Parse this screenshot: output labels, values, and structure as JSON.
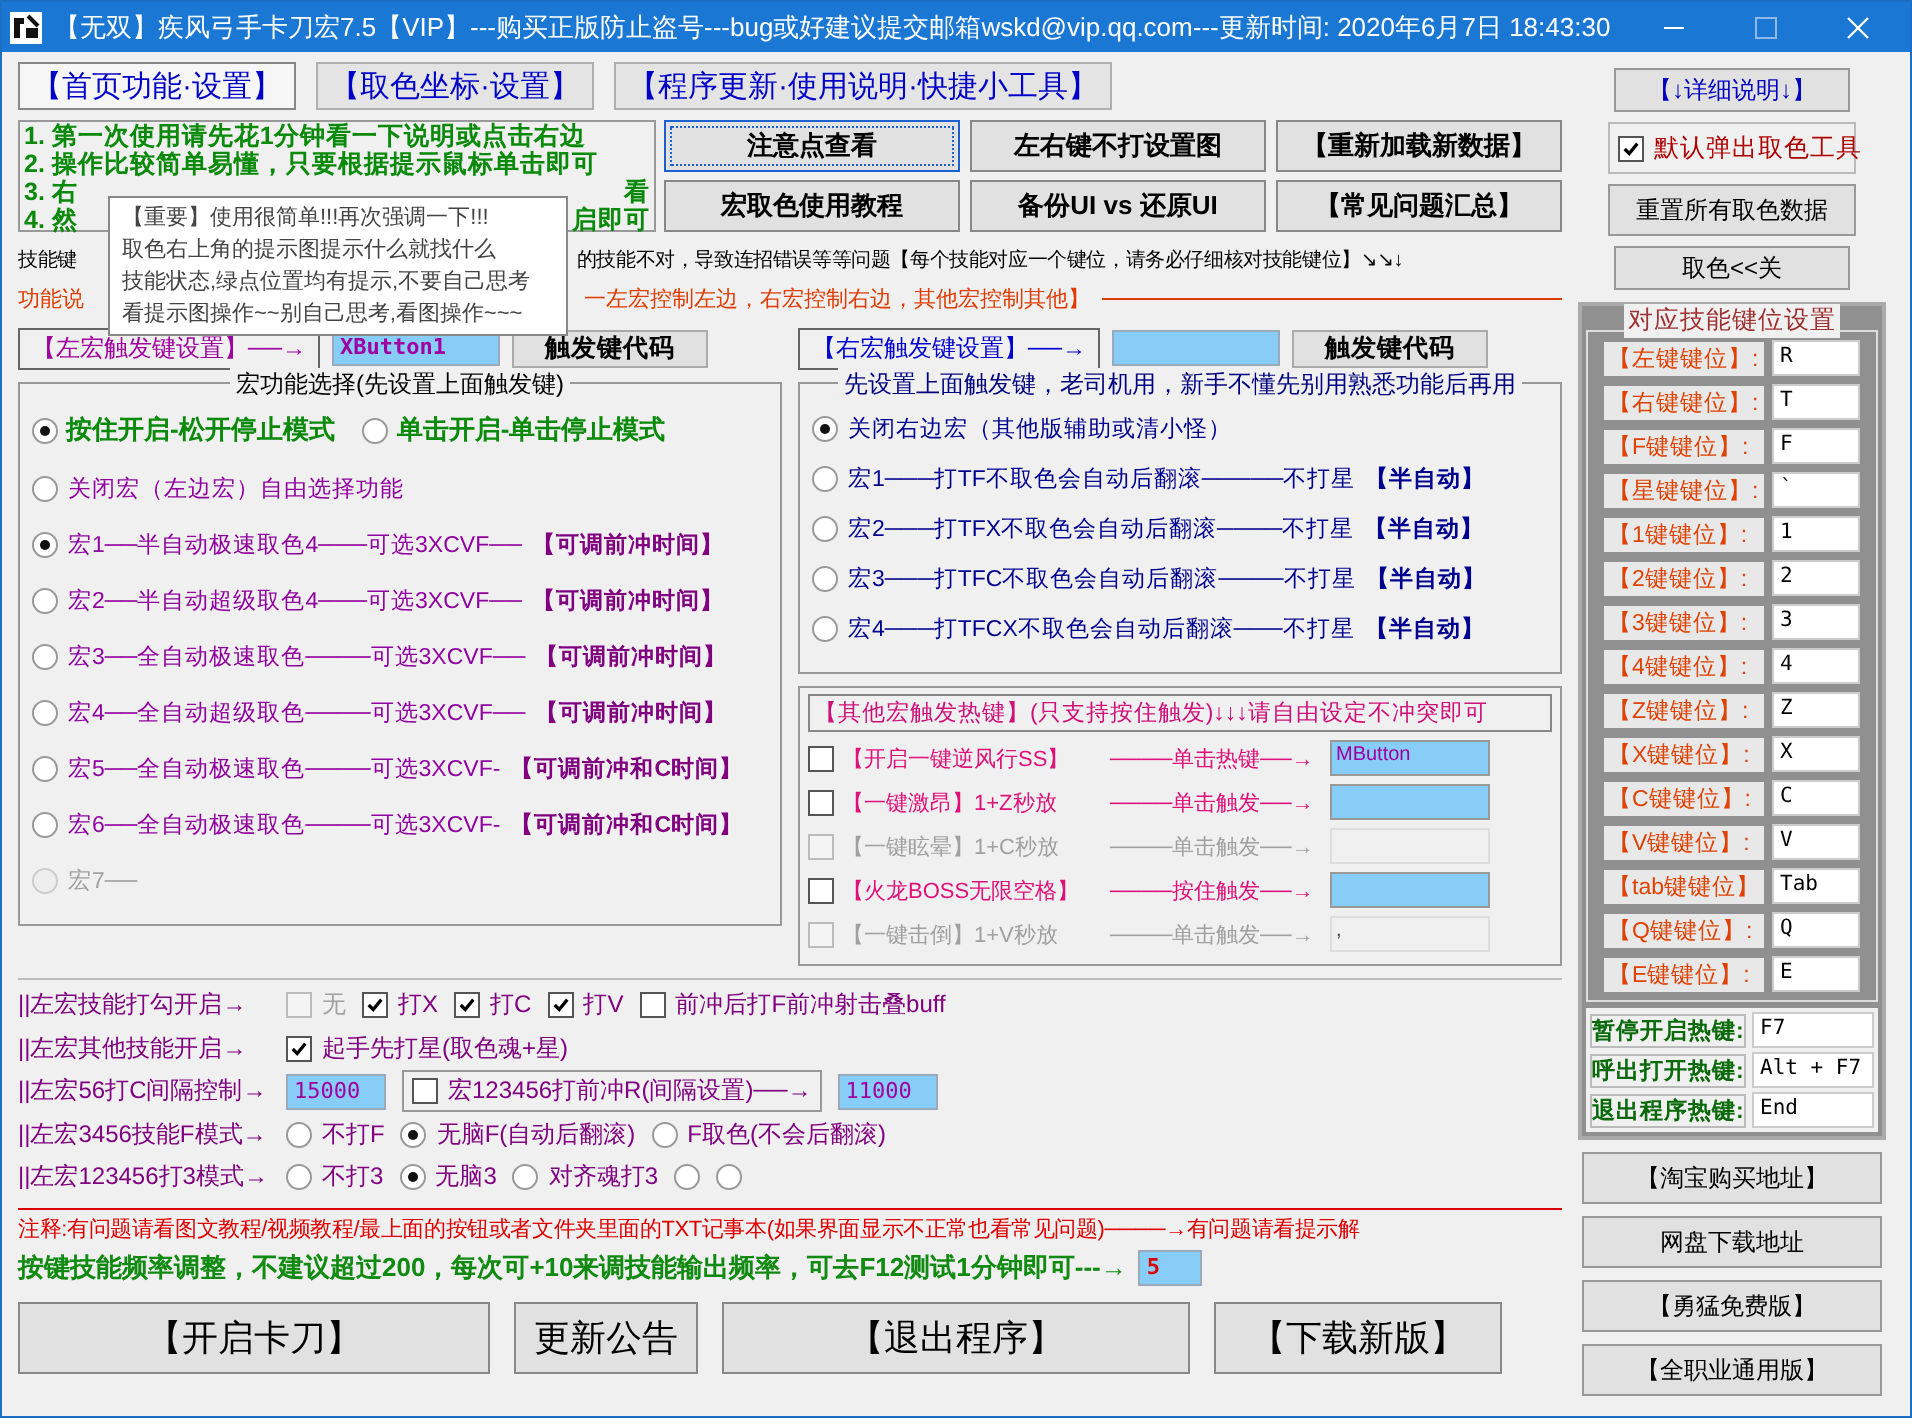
{
  "window": {
    "title": "【无双】疾风弓手卡刀宏7.5【VIP】---购买正版防止盗号---bug或好建议提交邮箱wskd@vip.qq.com---更新时间: 2020年6月7日 18:43:30"
  },
  "tabs": [
    {
      "label": "【首页功能·设置】",
      "selected": true
    },
    {
      "label": "【取色坐标·设置】",
      "selected": false
    },
    {
      "label": "【程序更新·使用说明·快捷小工具】",
      "selected": false
    }
  ],
  "intro_lines": [
    [
      "1. 第一次使用请先花1分钟看一下说明或点击右边"
    ],
    [
      "2. 操作比较简单易懂，只要根据提示鼠标单击即可"
    ],
    [
      "3. 右",
      "看"
    ],
    [
      "4. 然",
      "启即可"
    ]
  ],
  "top_buttons": [
    {
      "label": "注意点查看",
      "focused": true
    },
    {
      "label": "左右键不打设置图",
      "focused": false
    },
    {
      "label": "【重新加载新数据】",
      "focused": false
    },
    {
      "label": "宏取色使用教程",
      "focused": false
    },
    {
      "label": "备份UI vs 还原UI",
      "focused": false
    },
    {
      "label": "【常见问题汇总】",
      "focused": false
    }
  ],
  "tooltip": [
    "【重要】使用很简单!!!再次强调一下!!!",
    "取色右上角的提示图提示什么就找什么",
    "技能状态,绿点位置均有提示,不要自己思考",
    "看提示图操作~~别自己思考,看图操作~~~"
  ],
  "info_line": {
    "start": "技能键",
    "end": "的技能不对，导致连招错误等等问题【每个技能对应一个键位，请务必仔细核对技能键位】↘↘↓"
  },
  "function_line": {
    "start": "功能说",
    "end": "一左宏控制左边，右宏控制右边，其他宏控制其他】"
  },
  "left_trigger": {
    "label": "【左宏触发键设置】──→",
    "value": "XButton1",
    "button": "触发键代码"
  },
  "right_trigger": {
    "label": "【右宏触发键设置】──→",
    "button": "触发键代码"
  },
  "left_group": {
    "title": "宏功能选择(先设置上面触发键)",
    "modes": [
      {
        "label": "按住开启-松开停止模式",
        "selected": true
      },
      {
        "label": "单击开启-单击停止模式",
        "selected": false
      }
    ],
    "options": [
      {
        "label": "关闭宏（左边宏）自由选择功能",
        "selected": false,
        "disabled": false
      },
      {
        "label": "宏1──半自动极速取色4───可选3XCVF──",
        "note": "【可调前冲时间】",
        "selected": true,
        "disabled": false
      },
      {
        "label": "宏2──半自动超级取色4───可选3XCVF──",
        "note": "【可调前冲时间】",
        "selected": false,
        "disabled": false
      },
      {
        "label": "宏3──全自动极速取色────可选3XCVF──",
        "note": "【可调前冲时间】",
        "selected": false,
        "disabled": false
      },
      {
        "label": "宏4──全自动超级取色────可选3XCVF──",
        "note": "【可调前冲时间】",
        "selected": false,
        "disabled": false
      },
      {
        "label": "宏5──全自动极速取色────可选3XCVF-",
        "note": "【可调前冲和C时间】",
        "selected": false,
        "disabled": false
      },
      {
        "label": "宏6──全自动极速取色────可选3XCVF-",
        "note": "【可调前冲和C时间】",
        "selected": false,
        "disabled": false
      },
      {
        "label": "宏7──",
        "selected": false,
        "disabled": true
      }
    ]
  },
  "right_group": {
    "title": "先设置上面触发键，老司机用，新手不懂先别用熟悉功能后再用",
    "options": [
      {
        "label": "关闭右边宏（其他版辅助或清小怪）",
        "selected": true
      },
      {
        "label": "宏1───打TF不取色会自动后翻滚─────不打星",
        "note": "【半自动】",
        "selected": false
      },
      {
        "label": "宏2───打TFX不取色会自动后翻滚────不打星",
        "note": "【半自动】",
        "selected": false
      },
      {
        "label": "宏3───打TFC不取色会自动后翻滚────不打星",
        "note": "【半自动】",
        "selected": false
      },
      {
        "label": "宏4───打TFCX不取色会自动后翻滚───不打星",
        "note": "【半自动】",
        "selected": false
      }
    ]
  },
  "other_hotkeys": {
    "title": "【其他宏触发热键】(只支持按住触发)↓↓↓请自由设定不冲突即可",
    "rows": [
      {
        "label": "【开启一键逆风行SS】",
        "action": "────单击热键──→",
        "value": "MButton",
        "checked": false,
        "disabled": false
      },
      {
        "label": "【一键激昂】1+Z秒放",
        "action": "────单击触发──→",
        "checked": false,
        "disabled": false
      },
      {
        "label": "【一键眩晕】1+C秒放",
        "action": "────单击触发──→",
        "checked": false,
        "disabled": true
      },
      {
        "label": "【火龙BOSS无限空格】",
        "action": "────按住触发──→",
        "checked": false,
        "disabled": false
      },
      {
        "label": "【一键击倒】1+V秒放",
        "action": "────单击触发──→",
        "value": ",",
        "checked": false,
        "disabled": true
      }
    ]
  },
  "options_rows": [
    {
      "label": "||左宏技能打勾开启→",
      "controls": [
        {
          "kind": "check",
          "label": "无",
          "checked": false,
          "disabled": true
        },
        {
          "kind": "check",
          "label": "打X",
          "checked": true,
          "disabled": false
        },
        {
          "kind": "check",
          "label": "打C",
          "checked": true,
          "disabled": false
        },
        {
          "kind": "check",
          "label": "打V",
          "checked": true,
          "disabled": false
        },
        {
          "kind": "check",
          "label": "前冲后打F前冲射击叠buff",
          "checked": false,
          "disabled": false
        }
      ]
    },
    {
      "label": "||左宏其他技能开启→",
      "controls": [
        {
          "kind": "check",
          "label": "起手先打星(取色魂+星)",
          "checked": true,
          "disabled": false
        }
      ]
    },
    {
      "label": "||左宏56打C间隔控制→",
      "controls": [
        {
          "kind": "field",
          "value": "15000"
        },
        {
          "kind": "check",
          "label": "宏123456打前冲R(间隔设置)──→",
          "checked": false,
          "disabled": false,
          "framed": true
        },
        {
          "kind": "field",
          "value": "11000"
        }
      ]
    },
    {
      "label": "||左宏3456技能F模式→",
      "controls": [
        {
          "kind": "radio",
          "label": "不打F",
          "selected": false
        },
        {
          "kind": "radio",
          "label": "无脑F(自动后翻滚)",
          "selected": true
        },
        {
          "kind": "radio",
          "label": "F取色(不会后翻滚)",
          "selected": false
        }
      ]
    },
    {
      "label": "||左宏123456打3模式→",
      "controls": [
        {
          "kind": "radio",
          "label": "不打3",
          "selected": false
        },
        {
          "kind": "radio",
          "label": "无脑3",
          "selected": true
        },
        {
          "kind": "radio",
          "label": "对齐魂打3",
          "selected": false
        },
        {
          "kind": "radio",
          "selected": false
        },
        {
          "kind": "radio",
          "selected": false
        }
      ]
    }
  ],
  "note": "注释:有问题请看图文教程/视频教程/最上面的按钮或者文件夹里面的TXT记事本(如果界面显示不正常也看常见问题)────→有问题请看提示解",
  "frequency": {
    "text": "按键技能频率调整，不建议超过200，每次可+10来调技能输出频率，可去F12测试1分钟即可---→",
    "value": "5"
  },
  "bottom_buttons": [
    "【开启卡刀】",
    "更新公告",
    "【退出程序】",
    "【下载新版】"
  ],
  "right_panel": {
    "detail_button": "【↓详细说明↓】",
    "popup_check": {
      "label": "默认弹出取色工具",
      "checked": true
    },
    "buttons": [
      "重置所有取色数据",
      "取色<<关"
    ],
    "keys_title": "对应技能键位设置",
    "keys": [
      {
        "label": "【左键键位】:",
        "value": "R"
      },
      {
        "label": "【右键键位】:",
        "value": "T"
      },
      {
        "label": "【F键键位】:",
        "value": "F"
      },
      {
        "label": "【星键键位】:",
        "value": "`"
      },
      {
        "label": "【1键键位】:",
        "value": "1"
      },
      {
        "label": "【2键键位】:",
        "value": "2"
      },
      {
        "label": "【3键键位】:",
        "value": "3"
      },
      {
        "label": "【4键键位】:",
        "value": "4"
      },
      {
        "label": "【Z键键位】:",
        "value": "Z"
      },
      {
        "label": "【X键键位】:",
        "value": "X"
      },
      {
        "label": "【C键键位】:",
        "value": "C"
      },
      {
        "label": "【V键键位】:",
        "value": "V"
      },
      {
        "label": "【tab键键位】",
        "value": "Tab"
      },
      {
        "label": "【Q键键位】:",
        "value": "Q"
      },
      {
        "label": "【E键键位】:",
        "value": "E"
      }
    ],
    "hotkeys": [
      {
        "label": "暂停开启热键:",
        "value": "F7"
      },
      {
        "label": "呼出打开热键:",
        "value": "Alt + F7"
      },
      {
        "label": "退出程序热键:",
        "value": "End"
      }
    ],
    "links": [
      "【淘宝购买地址】",
      "网盘下载地址",
      "【勇猛免费版】",
      "【全职业通用版】"
    ]
  }
}
